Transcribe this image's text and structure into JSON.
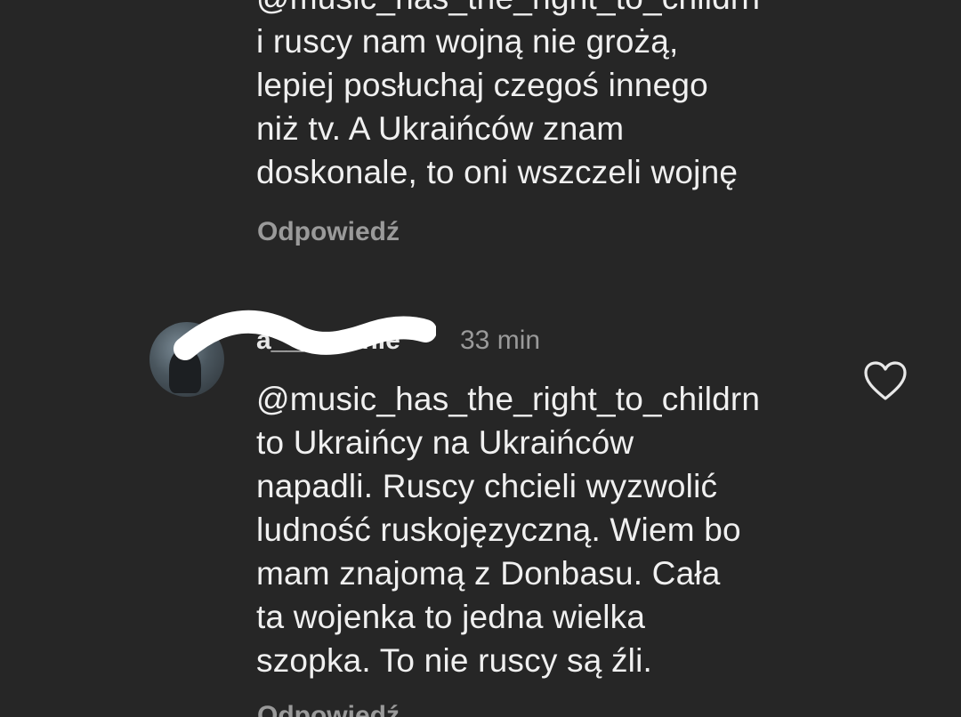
{
  "comments": [
    {
      "text": "@music_has_the_right_to_childrn\ni ruscy nam wojną nie grożą,\nlepiej posłuchaj czegoś innego\nniż tv. A Ukraińców znam\ndoskonale, to oni wszczeli wojnę",
      "reply_label": "Odpowiedź"
    },
    {
      "username": "a_____nnie",
      "timestamp": "33 min",
      "text": "@music_has_the_right_to_childrn\nto Ukraińcy na Ukraińców\nnapadli. Ruscy chcieli wyzwolić\nludność ruskojęzyczną. Wiem bo\nmam znajomą z Donbasu. Cała\nta wojenka to jedna wielka\nszopka. To nie ruscy są źli.",
      "reply_label": "Odpowiedź",
      "like_icon": "heart-outline-icon",
      "avatar_icon": "profile-photo"
    }
  ],
  "colors": {
    "background": "#262626",
    "text": "#f0f0f0",
    "muted": "#9a9a9a",
    "redaction": "#ffffff"
  }
}
